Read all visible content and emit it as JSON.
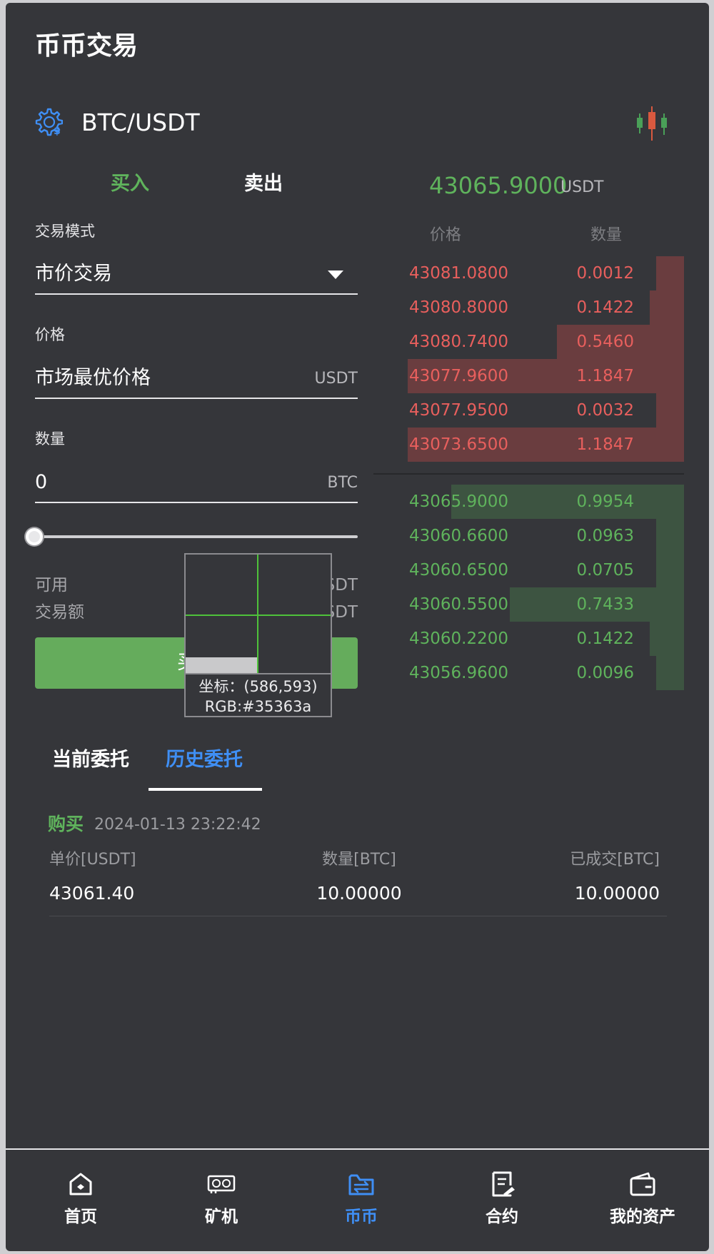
{
  "header": {
    "title": "币币交易"
  },
  "pair": {
    "symbol": "BTC/USDT",
    "settings_icon": "gear-dollar-icon",
    "chart_icon": "candlestick-chart-icon"
  },
  "side_tabs": {
    "buy": "买入",
    "sell": "卖出",
    "active": "buy"
  },
  "ticker": {
    "last_price": "43065.9000",
    "unit": "USDT"
  },
  "form": {
    "mode_label": "交易模式",
    "mode_value": "市价交易",
    "price_label": "价格",
    "price_value": "市场最优价格",
    "price_unit": "USDT",
    "qty_label": "数量",
    "qty_value": "0",
    "qty_unit": "BTC",
    "slider_percent": 0,
    "available_label": "可用",
    "available_value": "SDT",
    "amount_label": "交易额",
    "amount_value": "SDT",
    "submit_label": "买入"
  },
  "orderbook": {
    "price_header": "价格",
    "amount_header": "数量",
    "asks": [
      {
        "price": "43081.0800",
        "amount": "0.0012",
        "depth": 0.09
      },
      {
        "price": "43080.8000",
        "amount": "0.1422",
        "depth": 0.11
      },
      {
        "price": "43080.7400",
        "amount": "0.5460",
        "depth": 0.41
      },
      {
        "price": "43077.9600",
        "amount": "1.1847",
        "depth": 0.89
      },
      {
        "price": "43077.9500",
        "amount": "0.0032",
        "depth": 0.09
      },
      {
        "price": "43073.6500",
        "amount": "1.1847",
        "depth": 0.89
      }
    ],
    "bids": [
      {
        "price": "43065.9000",
        "amount": "0.9954",
        "depth": 0.75
      },
      {
        "price": "43060.6600",
        "amount": "0.0963",
        "depth": 0.09
      },
      {
        "price": "43060.6500",
        "amount": "0.0705",
        "depth": 0.09
      },
      {
        "price": "43060.5500",
        "amount": "0.7433",
        "depth": 0.56
      },
      {
        "price": "43060.2200",
        "amount": "0.1422",
        "depth": 0.11
      },
      {
        "price": "43056.9600",
        "amount": "0.0096",
        "depth": 0.09
      }
    ]
  },
  "picker": {
    "coord": "坐标：(586,593)",
    "rgb": "RGB:#35363a"
  },
  "orders": {
    "tab_current": "当前委托",
    "tab_history": "历史委托",
    "active_tab": "history",
    "records": [
      {
        "side": "购买",
        "time": "2024-01-13 23:22:42",
        "price_header": "单价[USDT]",
        "qty_header": "数量[BTC]",
        "filled_header": "已成交[BTC]",
        "price": "43061.40",
        "qty": "10.00000",
        "filled": "10.00000"
      }
    ]
  },
  "nav": {
    "items": [
      {
        "label": "首页",
        "icon": "home-icon"
      },
      {
        "label": "矿机",
        "icon": "graphics-card-icon"
      },
      {
        "label": "币币",
        "icon": "exchange-folder-icon"
      },
      {
        "label": "合约",
        "icon": "contract-icon"
      },
      {
        "label": "我的资产",
        "icon": "wallet-icon"
      }
    ],
    "active_index": 2
  },
  "colors": {
    "background": "#35363a",
    "buy": "#5fb35c",
    "sell": "#e85f5d",
    "accent": "#3f8ff5",
    "button": "#65ac5c"
  }
}
